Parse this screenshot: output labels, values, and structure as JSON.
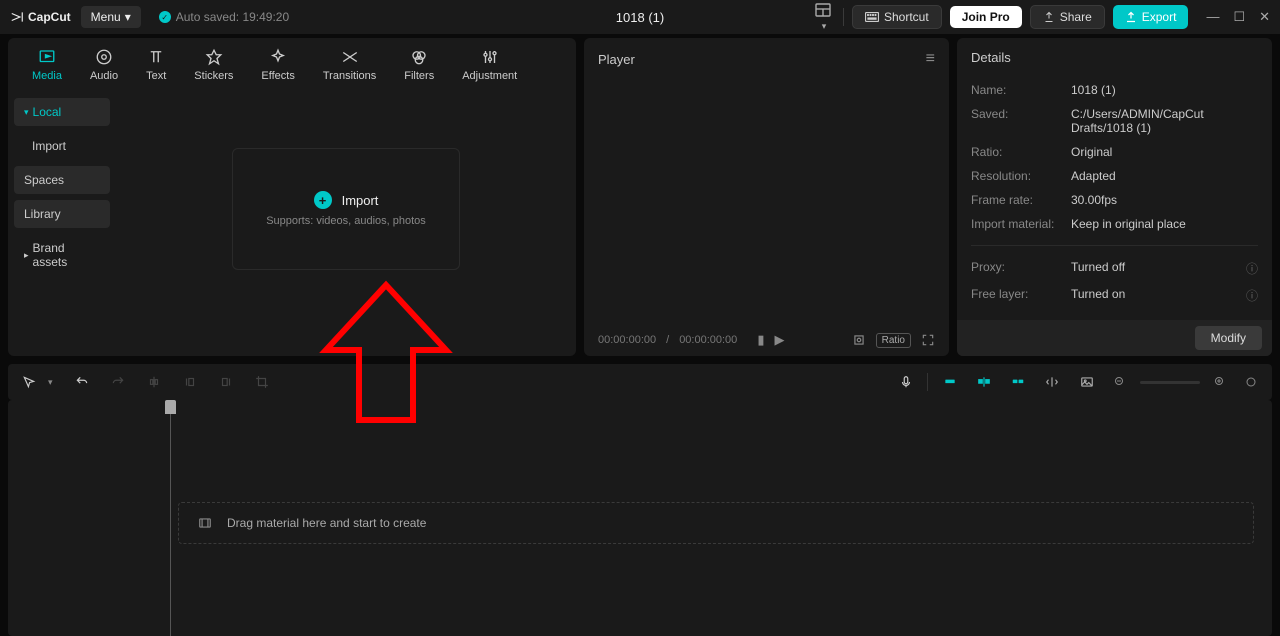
{
  "app": {
    "logo_text": "CapCut",
    "menu_label": "Menu",
    "autosave_text": "Auto saved: 19:49:20",
    "project_title": "1018 (1)",
    "shortcut_label": "Shortcut",
    "joinpro_label": "Join Pro",
    "share_label": "Share",
    "export_label": "Export"
  },
  "tabs": {
    "media": "Media",
    "audio": "Audio",
    "text": "Text",
    "stickers": "Stickers",
    "effects": "Effects",
    "transitions": "Transitions",
    "filters": "Filters",
    "adjustment": "Adjustment"
  },
  "sidebar": {
    "local": "Local",
    "import": "Import",
    "spaces": "Spaces",
    "library": "Library",
    "brand": "Brand assets"
  },
  "import_box": {
    "label": "Import",
    "sub": "Supports: videos, audios, photos"
  },
  "player": {
    "title": "Player",
    "time_current": "00:00:00:00",
    "time_total": "00:00:00:00"
  },
  "details": {
    "header": "Details",
    "name_k": "Name:",
    "name_v": "1018 (1)",
    "saved_k": "Saved:",
    "saved_v": "C:/Users/ADMIN/CapCut Drafts/1018 (1)",
    "ratio_k": "Ratio:",
    "ratio_v": "Original",
    "res_k": "Resolution:",
    "res_v": "Adapted",
    "fps_k": "Frame rate:",
    "fps_v": "30.00fps",
    "import_k": "Import material:",
    "import_v": "Keep in original place",
    "proxy_k": "Proxy:",
    "proxy_v": "Turned off",
    "free_k": "Free layer:",
    "free_v": "Turned on",
    "modify": "Modify"
  },
  "timeline": {
    "hint": "Drag material here and start to create"
  }
}
